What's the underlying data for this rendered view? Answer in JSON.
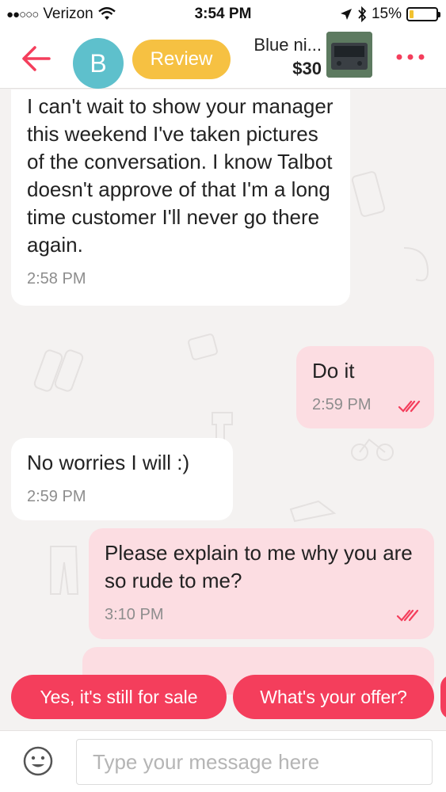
{
  "status_bar": {
    "signal": "●●○○○",
    "carrier": "Verizon",
    "time": "3:54 PM",
    "battery": "15%",
    "battery_level": 0.15
  },
  "header": {
    "avatar_letter": "B",
    "review_label": "Review",
    "item_title": "Blue ni...",
    "item_price": "$30"
  },
  "messages": [
    {
      "direction": "in",
      "text": "I can't wait to show your manager this weekend I've taken pictures of the conversation. I know Talbot doesn't approve of that I'm a long time customer I'll never go there again.",
      "time": "2:58 PM"
    },
    {
      "direction": "out",
      "text": "Do it",
      "time": "2:59 PM",
      "read": true
    },
    {
      "direction": "in",
      "text": "No worries I will :)",
      "time": "2:59 PM"
    },
    {
      "direction": "out",
      "text": "Please explain to me why you are so rude to me?",
      "time": "3:10 PM",
      "read": true
    }
  ],
  "quick_replies": [
    "Yes, it's still for sale",
    "What's your offer?"
  ],
  "input": {
    "placeholder": "Type your message here"
  },
  "colors": {
    "accent": "#f43e5c",
    "review": "#f6c142",
    "avatar": "#5ec0cc",
    "outgoing_bubble": "#fcdde2"
  }
}
